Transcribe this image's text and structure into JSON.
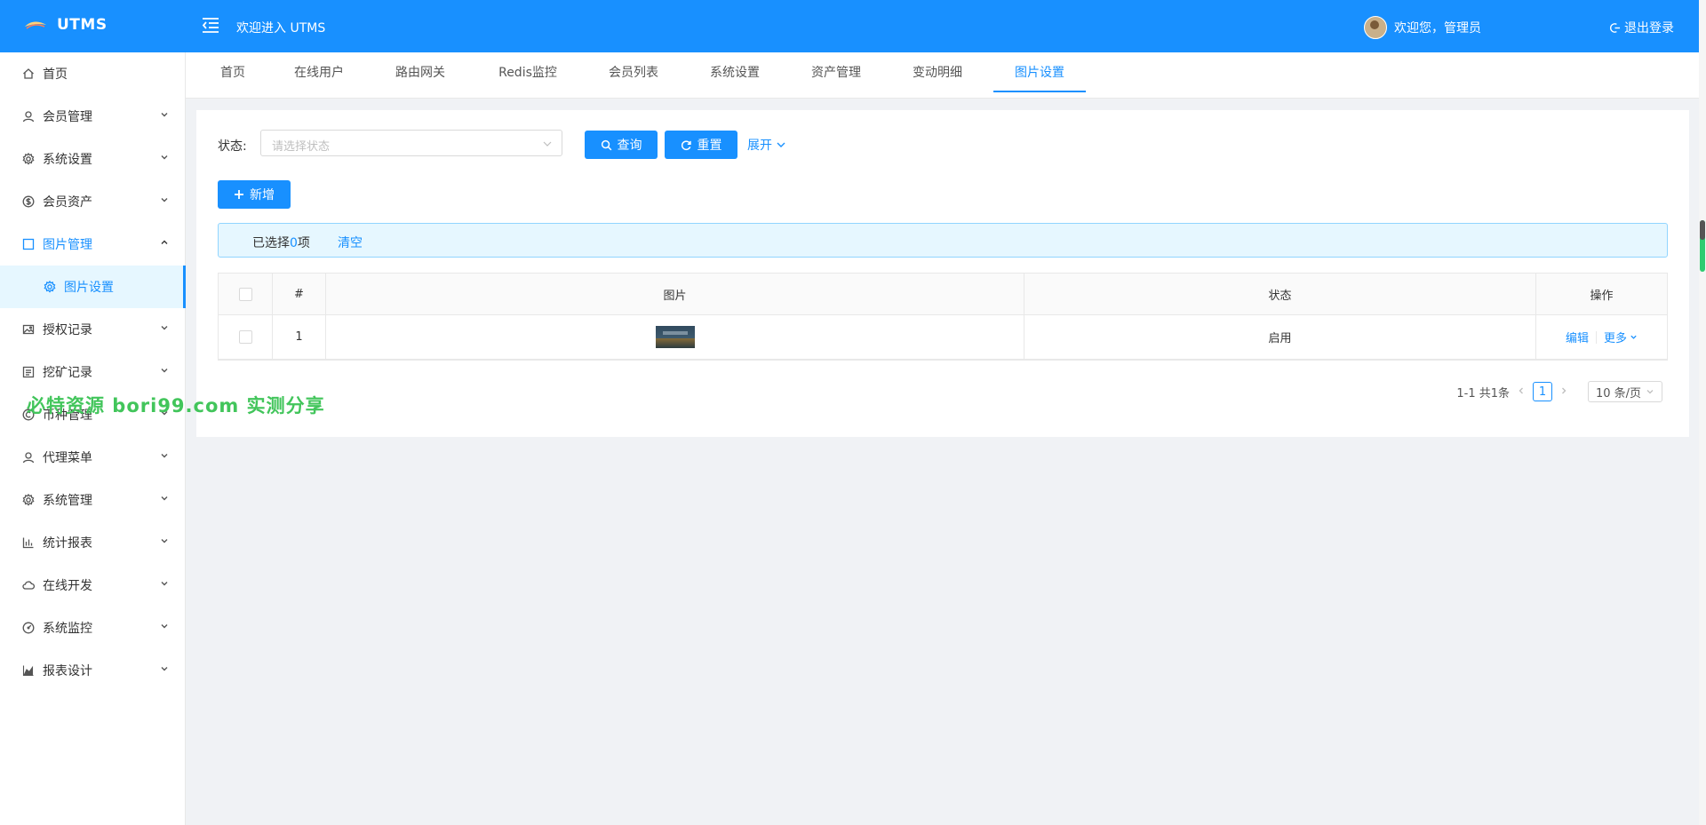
{
  "header": {
    "title": "UTMS",
    "welcome": "欢迎进入 UTMS",
    "user_greeting": "欢迎您，管理员",
    "logout": "退出登录",
    "brand_color": "#1890ff"
  },
  "sidebar": {
    "items": [
      {
        "label": "首页",
        "icon": "home-icon"
      },
      {
        "label": "会员管理",
        "icon": "user-icon"
      },
      {
        "label": "系统设置",
        "icon": "gear-icon"
      },
      {
        "label": "会员资产",
        "icon": "dollar-icon"
      },
      {
        "label": "图片管理",
        "icon": "square-icon"
      },
      {
        "label": "图片设置",
        "icon": "gear-icon"
      },
      {
        "label": "授权记录",
        "icon": "image-icon"
      },
      {
        "label": "挖矿记录",
        "icon": "list-icon"
      },
      {
        "label": "币种管理",
        "icon": "coin-icon"
      },
      {
        "label": "代理菜单",
        "icon": "user-icon"
      },
      {
        "label": "系统管理",
        "icon": "gear-icon"
      },
      {
        "label": "统计报表",
        "icon": "bar-chart-icon"
      },
      {
        "label": "在线开发",
        "icon": "cloud-icon"
      },
      {
        "label": "系统监控",
        "icon": "dashboard-icon"
      },
      {
        "label": "报表设计",
        "icon": "area-chart-icon"
      }
    ]
  },
  "watermark": "必特资源 bori99.com 实测分享",
  "tabs": [
    {
      "label": "首页"
    },
    {
      "label": "在线用户"
    },
    {
      "label": "路由网关"
    },
    {
      "label": "Redis监控"
    },
    {
      "label": "会员列表"
    },
    {
      "label": "系统设置"
    },
    {
      "label": "资产管理"
    },
    {
      "label": "变动明细"
    },
    {
      "label": "图片设置"
    }
  ],
  "filter": {
    "label": "状态:",
    "placeholder": "请选择状态",
    "search": "查询",
    "reset": "重置",
    "expand": "展开"
  },
  "toolbar": {
    "add": "新增"
  },
  "selection": {
    "prefix": "已选择",
    "count": "0",
    "suffix": "项",
    "clear": "清空"
  },
  "table": {
    "columns": {
      "index": "#",
      "image": "图片",
      "status": "状态",
      "actions": "操作"
    },
    "rows": [
      {
        "index": "1",
        "status": "启用",
        "edit": "编辑",
        "more": "更多"
      }
    ]
  },
  "pagination": {
    "summary": "1-1 共1条",
    "current": "1",
    "page_size": "10 条/页"
  }
}
